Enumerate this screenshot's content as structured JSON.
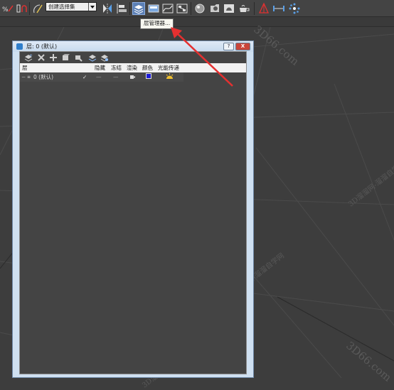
{
  "toolbar": {
    "buttons": [
      "link-icon",
      "unlink-icon",
      "bind-spacewarp-icon",
      "named-selection-icon",
      "mirror-icon",
      "align-icon",
      "layer-manager-icon",
      "toggle-ribbon-icon",
      "curve-editor-icon",
      "schematic-view-icon",
      "material-editor-icon",
      "render-setup-icon",
      "rendered-frame-icon",
      "render-production-icon",
      "measure-icon",
      "dimension-icon",
      "snapshot-icon"
    ],
    "selection_set_placeholder": "创建选择集",
    "tooltip": "层管理器..."
  },
  "layer_manager": {
    "title": "层: 0 (默认)",
    "help_button": "?",
    "close_button": "X",
    "tools": [
      "create-layer-icon",
      "delete-layer-icon",
      "add-to-layer-icon",
      "select-objects-icon",
      "highlight-layer-icon",
      "hide-all-icon",
      "freeze-all-icon"
    ],
    "columns": {
      "layer": "层",
      "hide": "隐藏",
      "freeze": "冻结",
      "render": "渲染",
      "color": "颜色",
      "radiosity": "光能传递"
    },
    "rows": [
      {
        "name": "0 (默认)",
        "active_check": "✓",
        "hide": "—",
        "freeze": "—",
        "color": "#1c1cd8"
      }
    ]
  },
  "watermarks": [
    "3D66.com",
    "3D溜溜网-溜溜自学网"
  ],
  "colors": {
    "toolbar": "#444444",
    "viewport": "#3d3d3d",
    "active_button": "#5b7fb5",
    "dialog_frame": "#cfe0f1",
    "panel": "#444444",
    "arrow": "#e53030",
    "close_button": "#c9453a"
  }
}
